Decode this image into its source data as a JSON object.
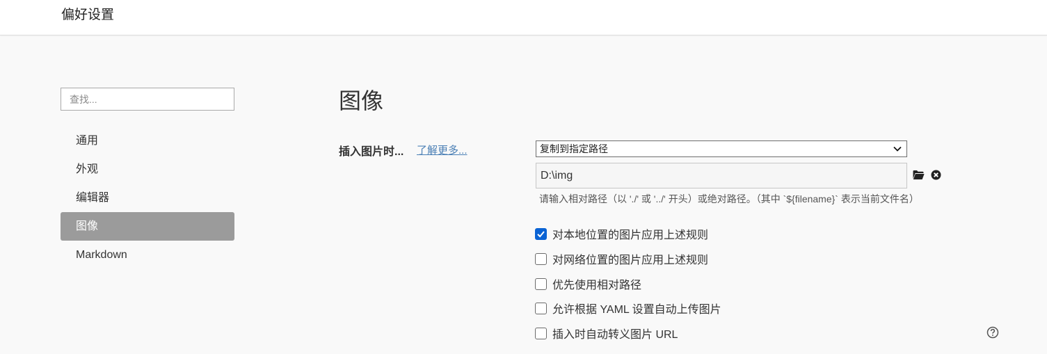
{
  "window": {
    "title": "偏好设置"
  },
  "sidebar": {
    "search_placeholder": "查找...",
    "items": [
      {
        "label": "通用",
        "active": false
      },
      {
        "label": "外观",
        "active": false
      },
      {
        "label": "编辑器",
        "active": false
      },
      {
        "label": "图像",
        "active": true
      },
      {
        "label": "Markdown",
        "active": false
      }
    ]
  },
  "main": {
    "heading": "图像",
    "insert_image": {
      "label": "插入图片时...",
      "learn_more": "了解更多...",
      "action_select": {
        "selected": "复制到指定路径"
      },
      "path_value": "D:\\img",
      "folder_icon": "folder-icon",
      "clear_icon": "clear-icon",
      "hint": "请输入相对路径（以 './' 或 '../' 开头）或绝对路径。（其中 `${filename}` 表示当前文件名）"
    },
    "options": [
      {
        "label": "对本地位置的图片应用上述规则",
        "checked": true
      },
      {
        "label": "对网络位置的图片应用上述规则",
        "checked": false
      },
      {
        "label": "优先使用相对路径",
        "checked": false
      },
      {
        "label": "允许根据 YAML 设置自动上传图片",
        "checked": false
      },
      {
        "label": "插入时自动转义图片 URL",
        "checked": false
      }
    ],
    "help_icon": "help-circle-icon"
  },
  "colors": {
    "accent": "#0a63d4",
    "active_nav_bg": "#9b9b9b",
    "link": "#4a7fb5",
    "page_bg": "#f9f9f9"
  }
}
